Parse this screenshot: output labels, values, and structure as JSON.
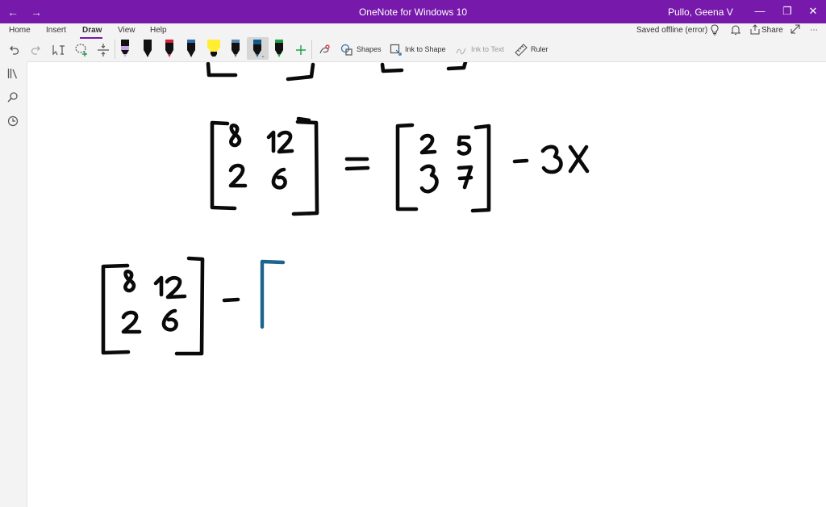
{
  "titlebar": {
    "back_icon": "←",
    "forward_icon": "→",
    "title": "OneNote for Windows 10",
    "user": "Pullo, Geena V",
    "minimize": "—",
    "restore": "❐",
    "close": "✕"
  },
  "ribbon": {
    "tabs": [
      {
        "label": "Home"
      },
      {
        "label": "Insert"
      },
      {
        "label": "Draw"
      },
      {
        "label": "View"
      },
      {
        "label": "Help"
      }
    ],
    "status": "Saved offline (error)",
    "share_label": "Share",
    "tools": {
      "shapes": "Shapes",
      "ink_to_shape": "Ink to Shape",
      "ink_to_text": "Ink to Text",
      "ruler": "Ruler"
    },
    "colors": {
      "accent": "#7719aa",
      "pen_lavender": "#c9a3e6",
      "pen_black": "#111111",
      "pen_red": "#d3203b",
      "pen_yellow": "#ffee32",
      "pen_blue": "#0f5a8c",
      "pen_green": "#1aa04a"
    }
  },
  "ink": {
    "colors": {
      "black": "#0a0a0a",
      "blue": "#1c6591"
    }
  }
}
